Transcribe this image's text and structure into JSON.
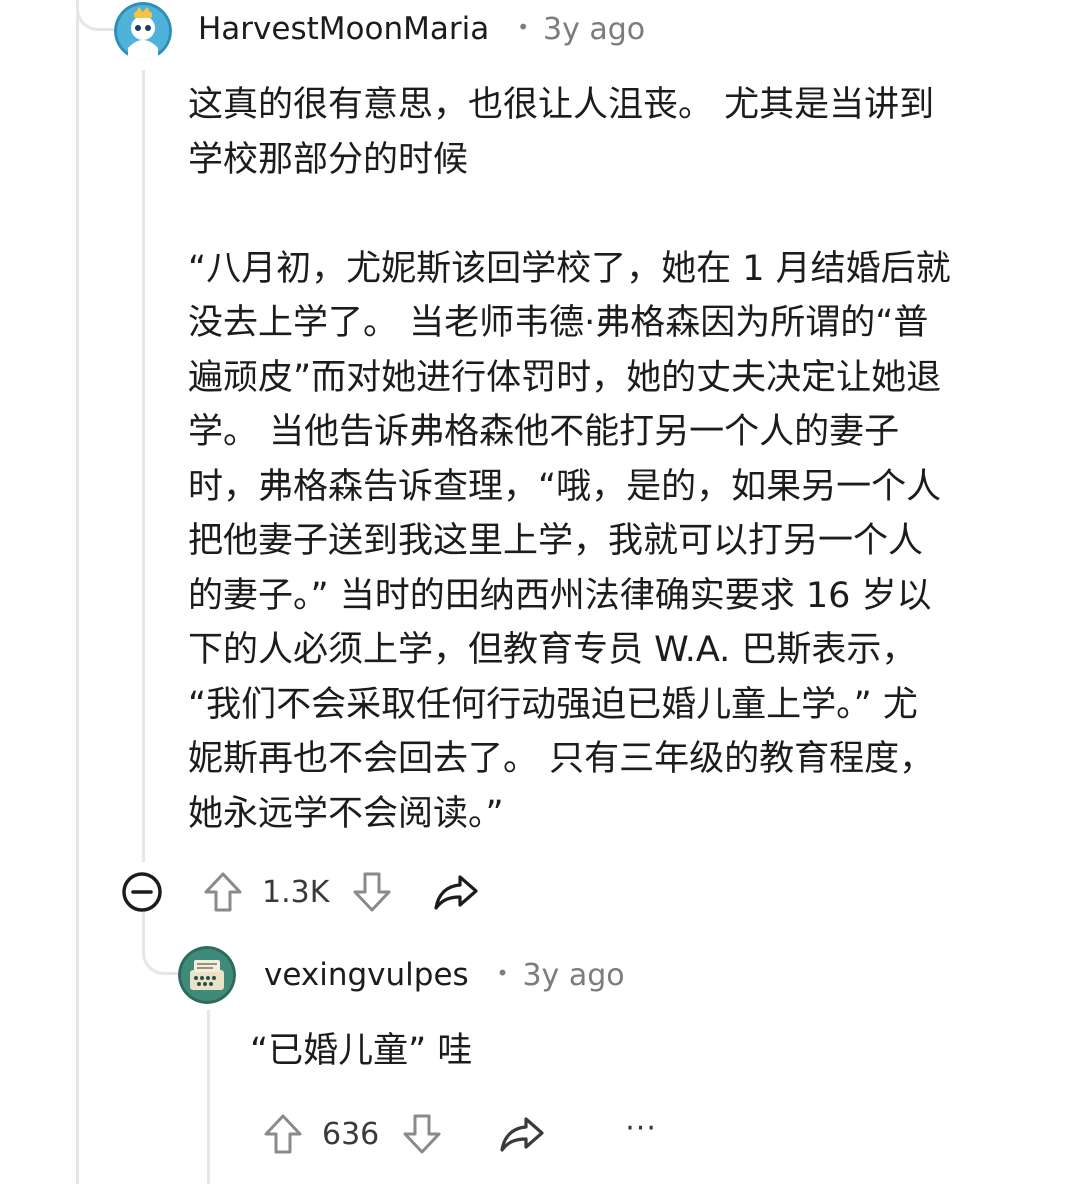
{
  "comment": {
    "username": "HarvestMoonMaria",
    "time": "3y ago",
    "body_lines": [
      "这真的很有意思，也很让人沮丧。 尤其是当讲到",
      "学校那部分的时候",
      "",
      "“八月初，尤妮斯该回学校了，她在 1 月结婚后就",
      "没去上学了。 当老师韦德·弗格森因为所谓的“普",
      "遍顽皮”而对她进行体罚时，她的丈夫决定让她退",
      "学。 当他告诉弗格森他不能打另一个人的妻子",
      "时，弗格森告诉查理，“哦，是的，如果另一个人",
      "把他妻子送到我这里上学，我就可以打另一个人",
      "的妻子。” 当时的田纳西州法律确实要求 16 岁以",
      "下的人必须上学，但教育专员 W.A. 巴斯表示，",
      "“我们不会采取任何行动强迫已婚儿童上学。” 尤",
      "妮斯再也不会回去了。 只有三年级的教育程度，",
      "她永远学不会阅读。”"
    ],
    "vote_count": "1.3K"
  },
  "reply": {
    "username": "vexingvulpes",
    "time": "3y ago",
    "body": "“已婚儿童” 哇",
    "vote_count": "636",
    "more": "···"
  },
  "separator": "•",
  "icons": {
    "collapse": "collapse-icon",
    "upvote": "upvote-icon",
    "downvote": "downvote-icon",
    "share": "share-icon",
    "more": "more-icon"
  }
}
